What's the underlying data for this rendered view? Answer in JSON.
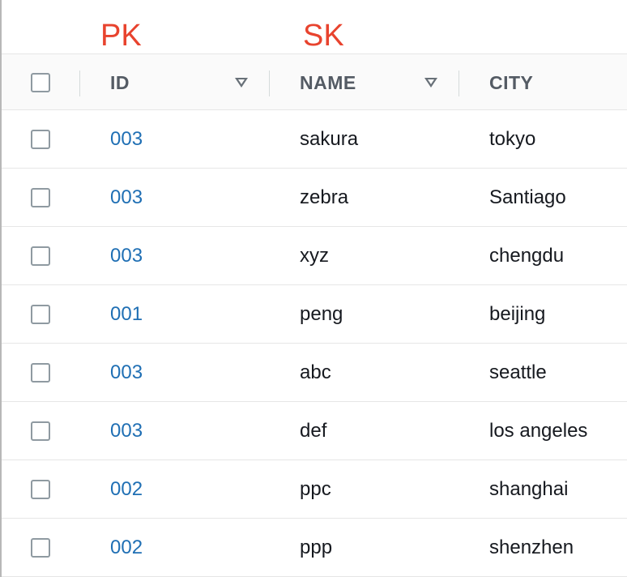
{
  "annotations": {
    "pk_label": "PK",
    "sk_label": "SK"
  },
  "table": {
    "columns": [
      {
        "key": "id",
        "label": "ID",
        "sortable": true
      },
      {
        "key": "name",
        "label": "NAME",
        "sortable": true
      },
      {
        "key": "city",
        "label": "CITY",
        "sortable": false
      }
    ],
    "rows": [
      {
        "id": "003",
        "name": "sakura",
        "city": "tokyo"
      },
      {
        "id": "003",
        "name": "zebra",
        "city": "Santiago"
      },
      {
        "id": "003",
        "name": "xyz",
        "city": "chengdu"
      },
      {
        "id": "001",
        "name": "peng",
        "city": "beijing"
      },
      {
        "id": "003",
        "name": "abc",
        "city": "seattle"
      },
      {
        "id": "003",
        "name": "def",
        "city": "los angeles"
      },
      {
        "id": "002",
        "name": "ppc",
        "city": "shanghai"
      },
      {
        "id": "002",
        "name": "ppp",
        "city": "shenzhen"
      }
    ]
  },
  "colors": {
    "annotation": "#e8432e",
    "link": "#1f6fb4",
    "header_text": "#545b64",
    "cell_text": "#16191f"
  },
  "icons": {
    "sort": "sort-caret-down-icon",
    "checkbox": "checkbox-unchecked-icon"
  }
}
